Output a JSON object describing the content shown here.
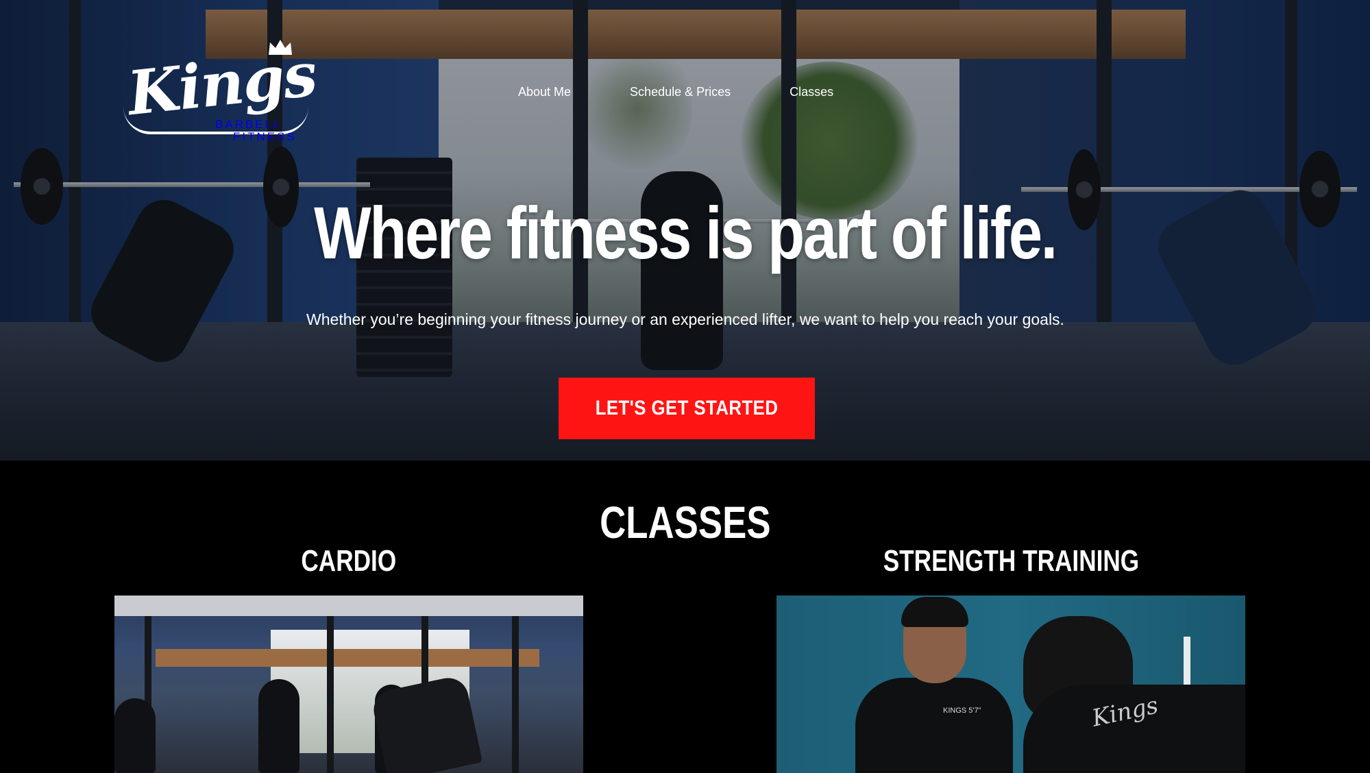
{
  "brand": {
    "logo_script": "Kings",
    "logo_line1": "BARBELL",
    "logo_line2": "FITNESS"
  },
  "nav": {
    "items": [
      {
        "label": "About Me"
      },
      {
        "label": "Schedule & Prices"
      },
      {
        "label": "Classes"
      }
    ]
  },
  "hero": {
    "title": "Where fitness is part of life.",
    "subtitle": "Whether you’re beginning your fitness journey or an experienced lifter, we want to help you reach your goals.",
    "cta_label": "LET'S GET STARTED",
    "cta_color": "#ff1414"
  },
  "classes": {
    "heading": "CLASSES",
    "cards": [
      {
        "title": "CARDIO"
      },
      {
        "title": "STRENGTH TRAINING"
      }
    ]
  },
  "image_text": {
    "shirt_front": "KINGS 5'7\"",
    "shirt_back": "Kings"
  }
}
